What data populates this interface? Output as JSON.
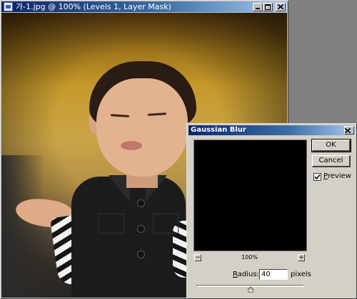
{
  "document_window": {
    "title": "가-1.jpg @ 100% (Levels 1, Layer Mask)",
    "title_icon": "photoshop-document-icon",
    "caption_buttons": [
      "minimize",
      "maximize",
      "close"
    ]
  },
  "dialog": {
    "title": "Gaussian Blur",
    "ok_label": "OK",
    "cancel_label": "Cancel",
    "preview_checkbox": {
      "label": "Preview",
      "checked": true
    },
    "zoom_level": "100%",
    "zoom_out_symbol": "−",
    "zoom_in_symbol": "+",
    "radius": {
      "label": "Radius:",
      "value": "40",
      "unit": "pixels"
    },
    "slider_position_fraction": 0.5
  },
  "colors": {
    "titlebar_active": "#0a246a",
    "dialog_face": "#d4d0c8",
    "preview_background": "#000000"
  }
}
